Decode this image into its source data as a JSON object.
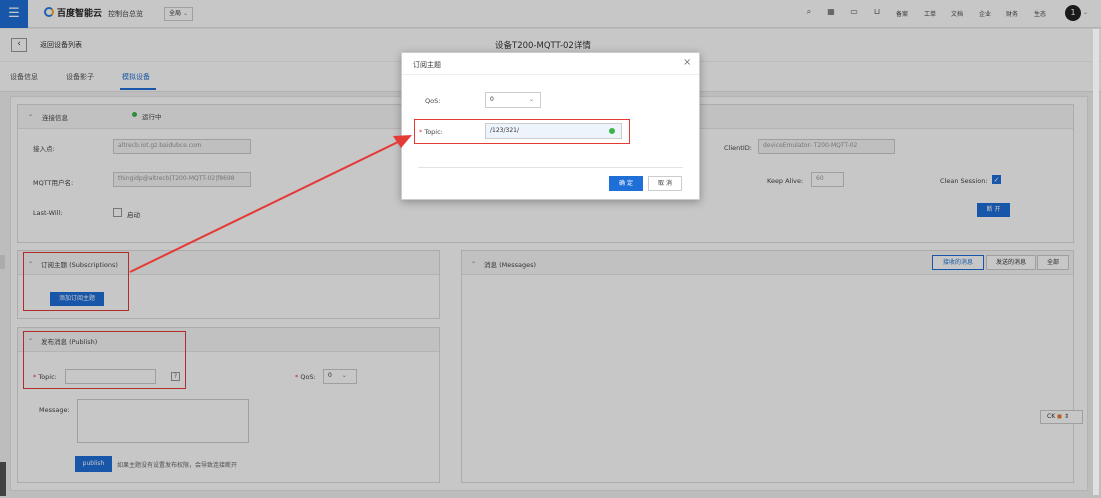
{
  "topbar": {
    "logo": "百度智能云",
    "console": "控制台总览",
    "region": "全局",
    "nav_items": [
      "备案",
      "工单",
      "文档",
      "企业",
      "财务",
      "生态"
    ],
    "avatar": "1"
  },
  "header": {
    "back_label": "返回设备列表",
    "title": "设备T200-MQTT-02详情"
  },
  "tabs": [
    {
      "label": "设备信息"
    },
    {
      "label": "设备影子"
    },
    {
      "label": "模拟设备"
    }
  ],
  "connection": {
    "title": "连接信息",
    "status": "运行中",
    "endpoint_label": "接入点:",
    "endpoint_value": "altrecb.iot.gz.baidubce.com",
    "username_label": "MQTT用户名:",
    "username_value": "thingidp@altrecb|T200-MQTT-02|f8698",
    "lastwill_label": "Last-Will:",
    "lastwill_checkbox": "启动",
    "clientid_label": "ClientID:",
    "clientid_value": "deviceEmulator-    T200-MQTT-02",
    "keepalive_label": "Keep Alive:",
    "keepalive_value": "60",
    "cleansession_label": "Clean Session:",
    "disconnect_label": "断 开"
  },
  "subscriptions": {
    "title": "订阅主题 (Subscriptions)",
    "add_button": "添加订阅主题"
  },
  "publish": {
    "title": "发布消息 (Publish)",
    "topic_label": "Topic:",
    "help_icon": "?",
    "qos_label": "QoS:",
    "qos_value": "0",
    "message_label": "Message:",
    "publish_button": "publish",
    "note": "如果主题没有设置发布权限，会导致连接断开"
  },
  "messages": {
    "title": "消息 (Messages)",
    "received": "接收的消息",
    "sent": "发送的消息",
    "all": "全部"
  },
  "dialog": {
    "title": "订阅主题",
    "close": "×",
    "qos_label": "QoS:",
    "qos_value": "0",
    "topic_label": "Topic:",
    "topic_value": "/123/321/",
    "confirm": "确 定",
    "cancel": "取 消"
  },
  "side_widget": "CK",
  "accent_color": "#1f6fd9",
  "annotation_color": "#e53935"
}
